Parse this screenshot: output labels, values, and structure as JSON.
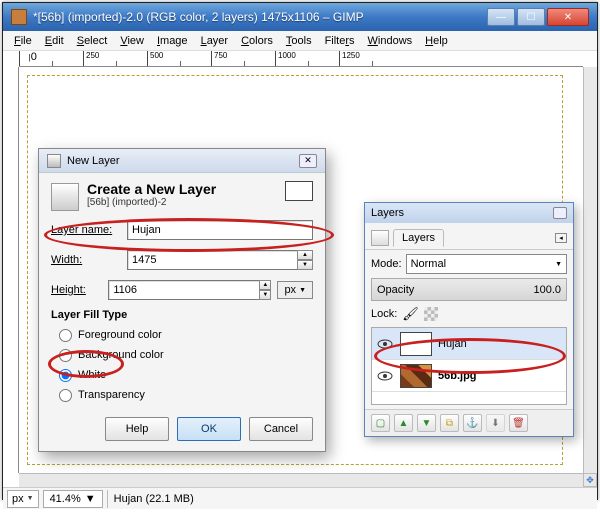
{
  "window": {
    "title": "*[56b] (imported)-2.0 (RGB color, 2 layers) 1475x1106 – GIMP"
  },
  "menu": {
    "file": "File",
    "edit": "Edit",
    "select": "Select",
    "view": "View",
    "image": "Image",
    "layer": "Layer",
    "colors": "Colors",
    "tools": "Tools",
    "filters": "Filters",
    "windows": "Windows",
    "help": "Help"
  },
  "ruler": {
    "t0": "0",
    "t1": "250",
    "t2": "500",
    "t3": "750",
    "t4": "1000",
    "t5": "1250"
  },
  "status": {
    "unit": "px",
    "zoom": "41.4%",
    "label": "Hujan (22.1 MB)"
  },
  "newLayer": {
    "title": "New Layer",
    "heading": "Create a New Layer",
    "sub": "[56b] (imported)-2",
    "name_lbl": "Layer name:",
    "name_val": "Hujan",
    "width_lbl": "Width:",
    "width_val": "1475",
    "height_lbl": "Height:",
    "height_val": "1106",
    "unit": "px",
    "fill_heading": "Layer Fill Type",
    "opt_fg": "Foreground color",
    "opt_bg": "Background color",
    "opt_white": "White",
    "opt_trans": "Transparency",
    "help": "Help",
    "ok": "OK",
    "cancel": "Cancel"
  },
  "layers": {
    "title": "Layers",
    "tab": "Layers",
    "mode_lbl": "Mode:",
    "mode_val": "Normal",
    "opacity_lbl": "Opacity",
    "opacity_val": "100.0",
    "lock_lbl": "Lock:",
    "row1": "Hujan",
    "row2": "56b.jpg"
  }
}
